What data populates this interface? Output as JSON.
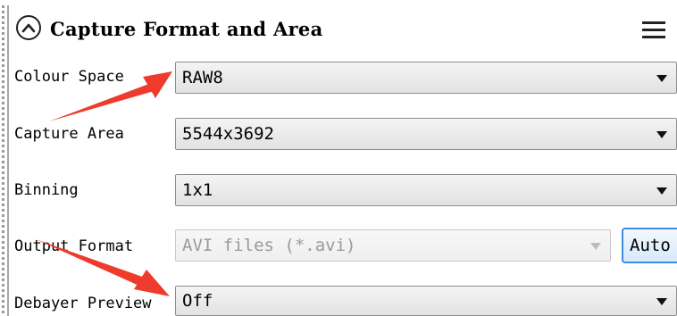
{
  "panel": {
    "title": "Capture Format and Area",
    "collapse_icon": "chevron-up-icon",
    "menu_icon": "hamburger-menu-icon"
  },
  "fields": {
    "colour_space": {
      "label": "Colour Space",
      "value": "RAW8"
    },
    "capture_area": {
      "label": "Capture Area",
      "value": "5544x3692"
    },
    "binning": {
      "label": "Binning",
      "value": "1x1"
    },
    "output_format": {
      "label": "Output Format",
      "value": "AVI files (*.avi)",
      "auto_button": "Auto"
    },
    "debayer_preview": {
      "label": "Debayer Preview",
      "value": "Off"
    }
  },
  "annotations": {
    "arrow_color": "#ee3b2b"
  },
  "colors": {
    "auto_button_border": "#3d8ee0"
  }
}
